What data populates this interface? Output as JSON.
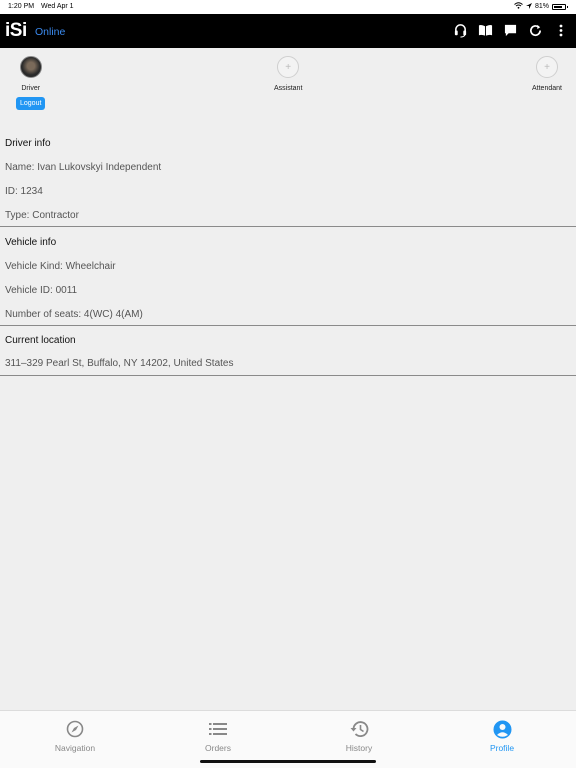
{
  "status_bar": {
    "time": "1:20 PM",
    "date": "Wed Apr 1",
    "battery": "81%",
    "battery_level": 0.81
  },
  "header": {
    "logo": "iSi",
    "status": "Online"
  },
  "crew": {
    "driver_label": "Driver",
    "logout_label": "Logout",
    "assistant_label": "Assistant",
    "attendant_label": "Attendant",
    "add_glyph": "+"
  },
  "driver_info": {
    "title": "Driver info",
    "name": "Name: Ivan Lukovskyi Independent",
    "id": "ID: 1234",
    "type": "Type: Contractor"
  },
  "vehicle_info": {
    "title": "Vehicle info",
    "kind": "Vehicle Kind: Wheelchair",
    "vehicle_id": "Vehicle ID: 0011",
    "seats": "Number of seats: 4(WC) 4(AM)"
  },
  "current_location": {
    "title": "Current location",
    "address": "311–329 Pearl St, Buffalo, NY  14202, United States"
  },
  "tabs": [
    {
      "label": "Navigation",
      "icon": "navigation-icon"
    },
    {
      "label": "Orders",
      "icon": "list-icon"
    },
    {
      "label": "History",
      "icon": "history-icon"
    },
    {
      "label": "Profile",
      "icon": "profile-icon",
      "active": true
    }
  ],
  "colors": {
    "accent": "#2196f3",
    "online": "#3b8bf0",
    "header_bg": "#000000",
    "page_bg": "#efefef"
  }
}
